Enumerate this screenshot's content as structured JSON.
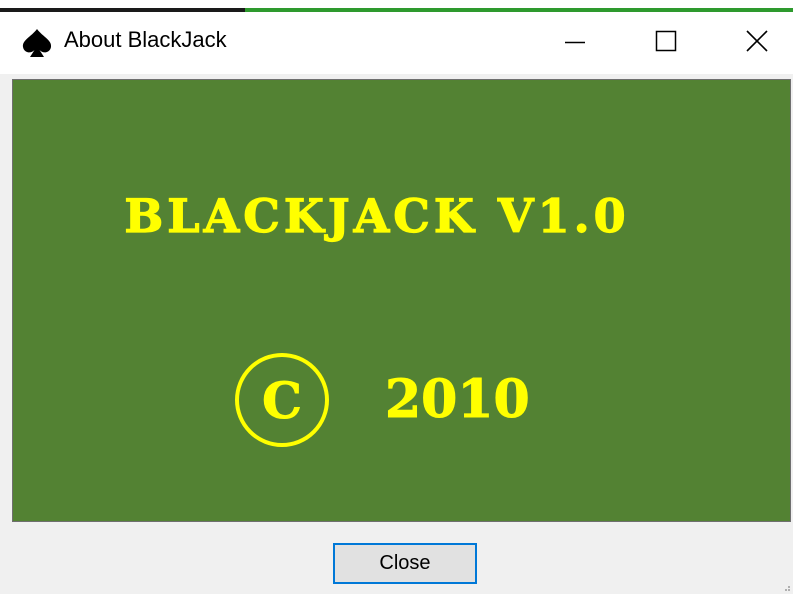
{
  "window": {
    "title": "About BlackJack",
    "icon": "spade-icon",
    "controls": [
      "minimize-icon",
      "maximize-icon",
      "close-icon"
    ]
  },
  "panel": {
    "heading": "BLACKJACK V1.0",
    "copyright_symbol": "C",
    "year": "2010",
    "background_color": "#538233",
    "text_color": "#ffff00"
  },
  "buttons": {
    "close_label": "Close"
  }
}
